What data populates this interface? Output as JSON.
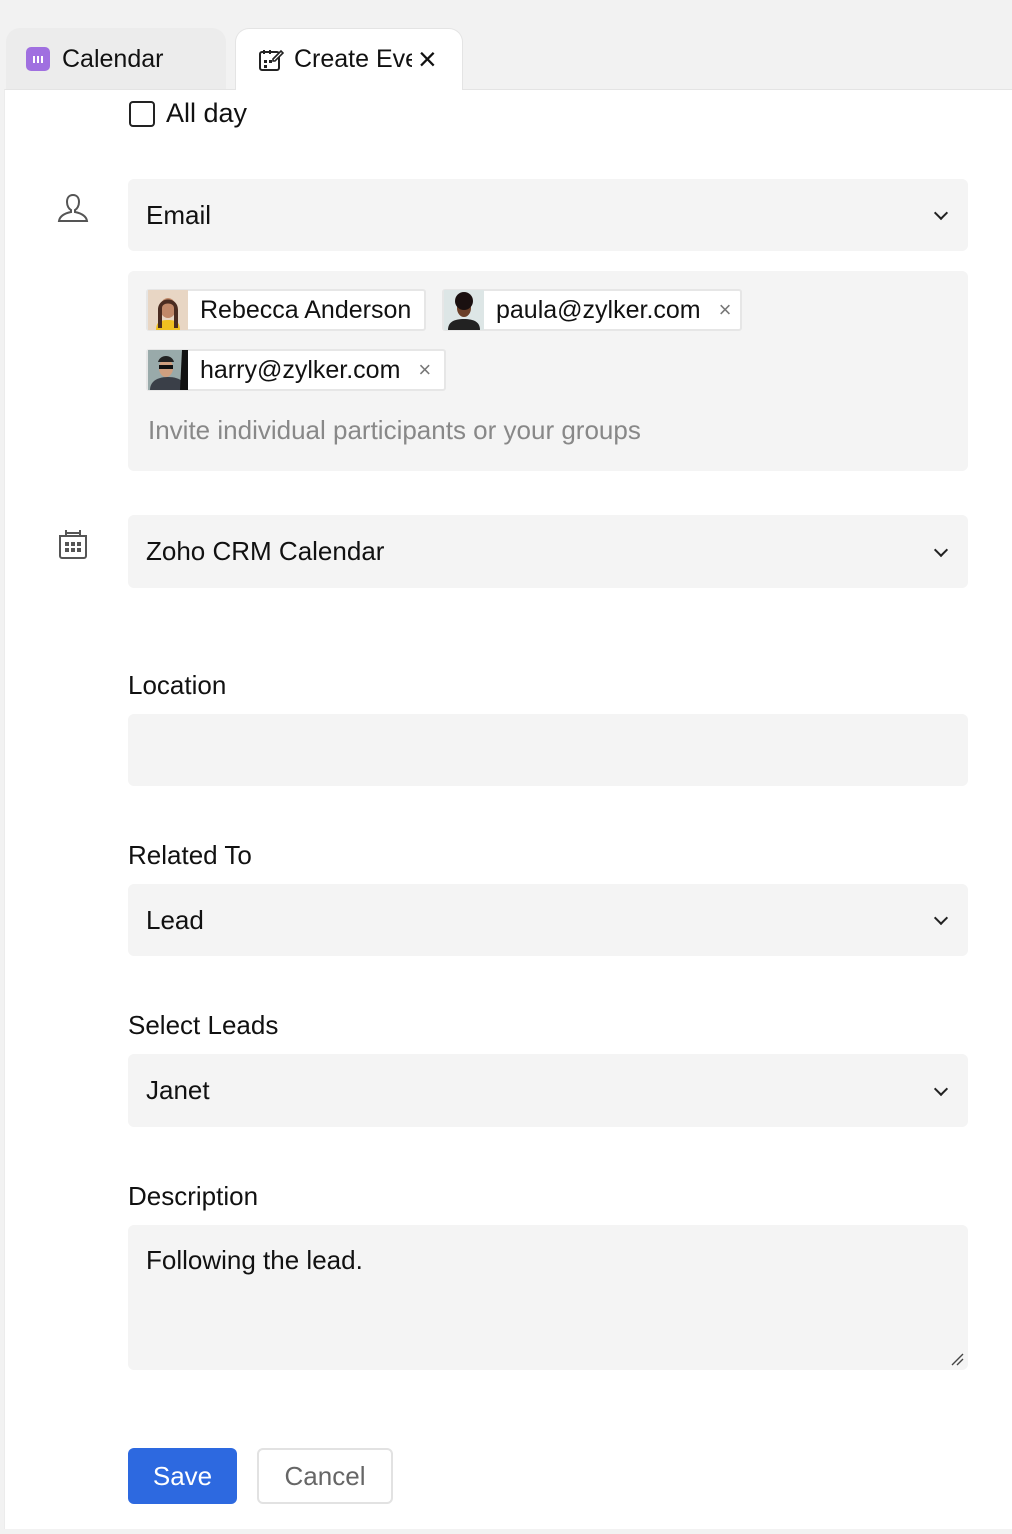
{
  "tabs": [
    {
      "label": "Calendar",
      "icon": "calendar-app-icon"
    },
    {
      "label": "Create Eve",
      "icon": "calendar-edit-icon",
      "close": "×"
    }
  ],
  "allday": {
    "label": "All day",
    "checked": false
  },
  "participants": {
    "type": "Email",
    "chips": [
      {
        "name": "Rebecca Anderson"
      },
      {
        "name": "paula@zylker.com",
        "remove": "×"
      },
      {
        "name": "harry@zylker.com",
        "remove": "×"
      }
    ],
    "placeholder": "Invite individual participants or your groups"
  },
  "calendar": {
    "value": "Zoho CRM Calendar"
  },
  "location": {
    "label": "Location",
    "value": ""
  },
  "related": {
    "label": "Related To",
    "value": "Lead"
  },
  "leads": {
    "label": "Select Leads",
    "value": "Janet"
  },
  "description": {
    "label": "Description",
    "value": "Following the lead."
  },
  "buttons": {
    "save": "Save",
    "cancel": "Cancel"
  },
  "colors": {
    "primary": "#2d69e0",
    "field_bg": "#f4f4f4",
    "calendar_icon": "#a070e0"
  }
}
